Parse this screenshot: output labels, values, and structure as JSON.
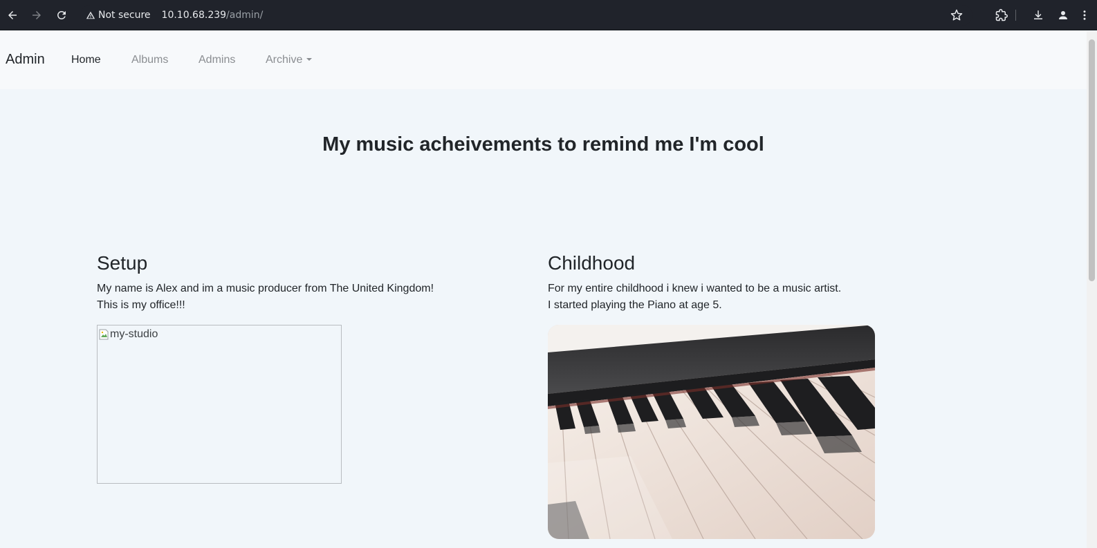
{
  "browser": {
    "security_label": "Not secure",
    "url_host": "10.10.68.239",
    "url_path": "/admin/"
  },
  "navbar": {
    "brand": "Admin",
    "links": [
      {
        "label": "Home",
        "active": true
      },
      {
        "label": "Albums",
        "active": false
      },
      {
        "label": "Admins",
        "active": false
      },
      {
        "label": "Archive",
        "active": false,
        "dropdown": true
      }
    ]
  },
  "hero": {
    "title": "My music acheivements to remind me I'm cool"
  },
  "sections": [
    {
      "heading": "Setup",
      "lines": [
        "My name is Alex and im a music producer from The United Kingdom!",
        "This is my office!!!"
      ],
      "image_alt": "my-studio",
      "image_state": "broken"
    },
    {
      "heading": "Childhood",
      "lines": [
        "For my entire childhood i knew i wanted to be a music artist.",
        "I started playing the Piano at age 5."
      ],
      "image_subject": "piano keys"
    }
  ],
  "colors": {
    "page_bg": "#f1f6fa",
    "navbar_bg": "#f7f9fb",
    "chrome_bg": "#20232b"
  }
}
